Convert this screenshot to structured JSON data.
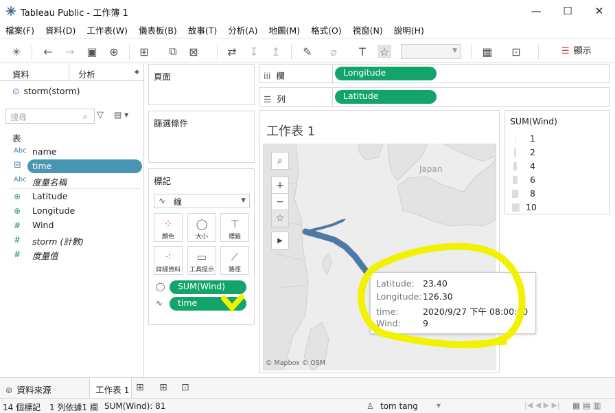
{
  "window": {
    "title": "Tableau Public - 工作簿 1",
    "minimize": "—",
    "maximize": "☐",
    "close": "✕"
  },
  "menu": [
    "檔案(F)",
    "資料(D)",
    "工作表(W)",
    "儀表板(B)",
    "故事(T)",
    "分析(A)",
    "地圖(M)",
    "格式(O)",
    "視窗(N)",
    "說明(H)"
  ],
  "toolbar": {
    "show_label": "顯示"
  },
  "data_pane": {
    "tab_data": "資料",
    "tab_analysis": "分析",
    "datasource": "storm(storm)",
    "search_placeholder": "搜尋",
    "section_tables": "表",
    "fields": [
      {
        "icon": "Abc",
        "label": "name",
        "italic": false,
        "kind": "dim"
      },
      {
        "icon": "date-icon",
        "label": "time",
        "italic": false,
        "kind": "dim",
        "selected": true
      },
      {
        "icon": "Abc",
        "label": "度量名稱",
        "italic": true,
        "kind": "dim"
      },
      {
        "icon": "globe-icon",
        "label": "Latitude",
        "italic": false,
        "kind": "meas"
      },
      {
        "icon": "globe-icon",
        "label": "Longitude",
        "italic": false,
        "kind": "meas"
      },
      {
        "icon": "#",
        "label": "Wind",
        "italic": false,
        "kind": "meas"
      },
      {
        "icon": "#",
        "label": "storm (計數)",
        "italic": true,
        "kind": "meas"
      },
      {
        "icon": "#",
        "label": "度量值",
        "italic": true,
        "kind": "meas"
      }
    ]
  },
  "shelves": {
    "pages": "頁面",
    "filters": "篩選條件",
    "marks": "標記",
    "mark_type": "線",
    "mark_buttons": [
      "顏色",
      "大小",
      "標籤",
      "詳細資料",
      "工具提示",
      "路徑"
    ],
    "mark_pills": [
      "SUM(Wind)",
      "time"
    ],
    "columns_label": "欄",
    "rows_label": "列",
    "columns_pill": "Longitude",
    "rows_pill": "Latitude"
  },
  "sheet": {
    "title": "工作表 1",
    "map_label": "Japan",
    "attribution": "© Mapbox © OSM"
  },
  "legend": {
    "title": "SUM(Wind)",
    "items": [
      "1",
      "2",
      "4",
      "6",
      "8",
      "10"
    ]
  },
  "tooltip": {
    "rows": [
      {
        "k": "Latitude:",
        "v": "23.40"
      },
      {
        "k": "Longitude:",
        "v": "126.30"
      },
      {
        "k": "time:",
        "v": "2020/9/27 下午 08:00:00"
      },
      {
        "k": "Wind:",
        "v": "9"
      }
    ]
  },
  "bottom_tabs": {
    "datasource": "資料來源",
    "sheet1": "工作表 1"
  },
  "status": {
    "marks": "14 個標記",
    "rows_cols": "1 列依據1 欄",
    "sum": "SUM(Wind): 81",
    "user": "tom tang"
  }
}
